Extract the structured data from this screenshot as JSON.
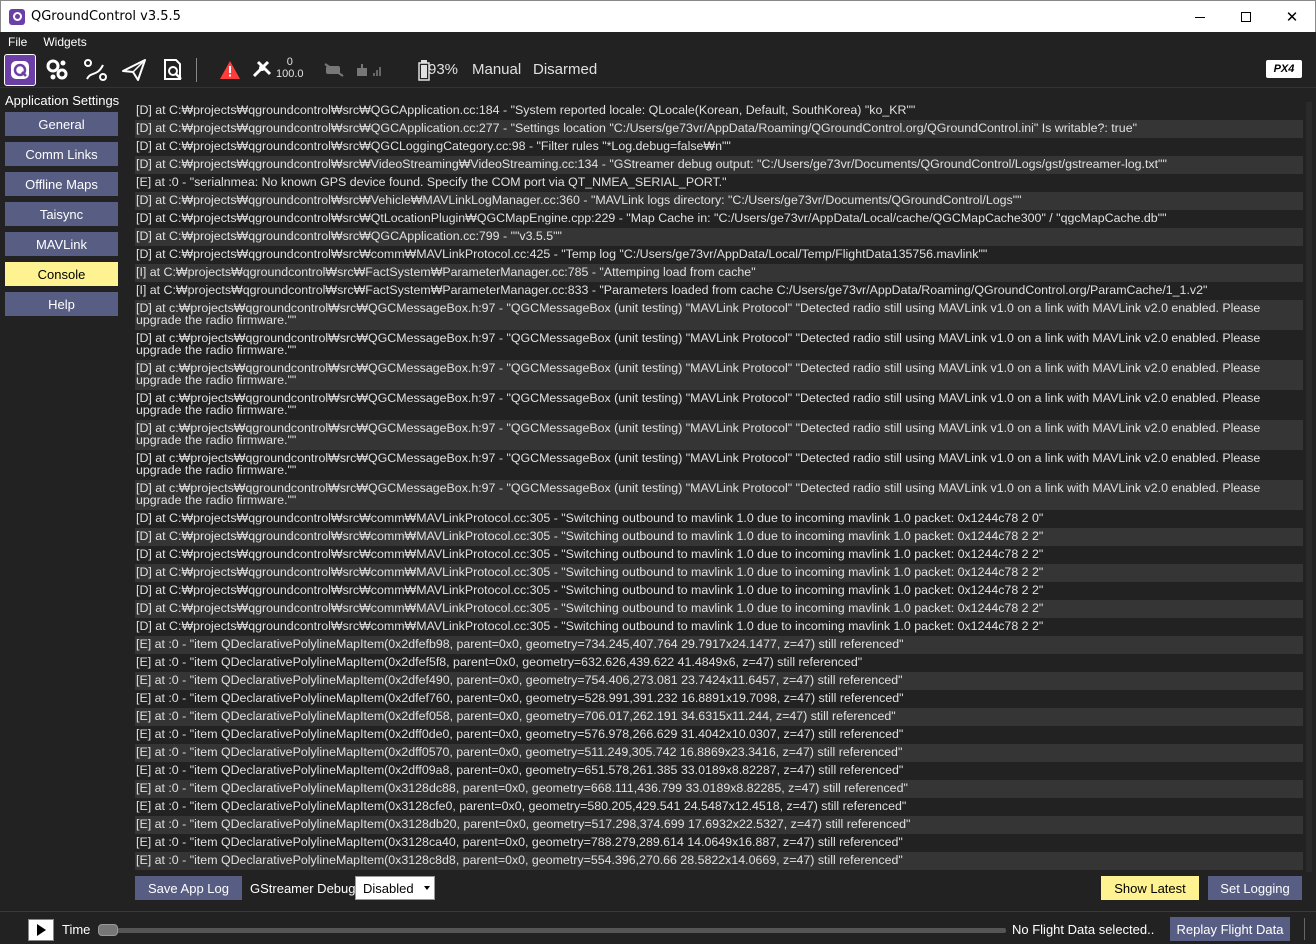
{
  "window": {
    "title": "QGroundControl v3.5.5",
    "minimize_icon": "minimize-icon",
    "maximize_icon": "maximize-icon",
    "close_glyph": "✕"
  },
  "menubar": {
    "items": [
      "File",
      "Widgets"
    ]
  },
  "toolbar": {
    "rssi_top": "0",
    "rssi_bottom": "100.0",
    "battery": "93%",
    "flight_mode": "Manual",
    "arm_state": "Disarmed",
    "brand_badge": "PX4",
    "icons": [
      "qgc-logo-icon",
      "gear-cluster-icon",
      "plan-waypoints-icon",
      "fly-paper-plane-icon",
      "analyze-doc-icon",
      "warning-triangle-icon",
      "gps-drone-icon",
      "telemetry-rc-icon",
      "radio-signal-icon",
      "battery-icon",
      "px4-logo-icon"
    ],
    "warning_color": "#ff3d3d"
  },
  "sidebar": {
    "header": "Application Settings",
    "items": [
      {
        "label": "General",
        "active": false
      },
      {
        "label": "Comm Links",
        "active": false
      },
      {
        "label": "Offline Maps",
        "active": false
      },
      {
        "label": "Taisync",
        "active": false
      },
      {
        "label": "MAVLink",
        "active": false
      },
      {
        "label": "Console",
        "active": true
      },
      {
        "label": "Help",
        "active": false
      }
    ]
  },
  "console": {
    "lines": [
      "[D] at C:₩projects₩qgroundcontrol₩src₩QGCApplication.cc:184 - \"System reported locale: QLocale(Korean, Default, SouthKorea) \"ko_KR\"\"",
      "[D] at C:₩projects₩qgroundcontrol₩src₩QGCApplication.cc:277 - \"Settings location \"C:/Users/ge73vr/AppData/Roaming/QGroundControl.org/QGroundControl.ini\" Is writable?: true\"",
      "[D] at C:₩projects₩qgroundcontrol₩src₩QGCLoggingCategory.cc:98 - \"Filter rules \"*Log.debug=false₩n\"\"",
      "[D] at C:₩projects₩qgroundcontrol₩src₩VideoStreaming₩VideoStreaming.cc:134 - \"GStreamer debug output: \"C:/Users/ge73vr/Documents/QGroundControl/Logs/gst/gstreamer-log.txt\"\"",
      "[E] at :0 - \"serialnmea: No known GPS device found. Specify the COM port via QT_NMEA_SERIAL_PORT.\"",
      "[D] at C:₩projects₩qgroundcontrol₩src₩Vehicle₩MAVLinkLogManager.cc:360 - \"MAVLink logs directory: \"C:/Users/ge73vr/Documents/QGroundControl/Logs\"\"",
      "[D] at C:₩projects₩qgroundcontrol₩src₩QtLocationPlugin₩QGCMapEngine.cpp:229 - \"Map Cache in: \"C:/Users/ge73vr/AppData/Local/cache/QGCMapCache300\" / \"qgcMapCache.db\"\"",
      "[D] at C:₩projects₩qgroundcontrol₩src₩QGCApplication.cc:799 - \"\"v3.5.5\"\"",
      "[D] at C:₩projects₩qgroundcontrol₩src₩comm₩MAVLinkProtocol.cc:425 - \"Temp log \"C:/Users/ge73vr/AppData/Local/Temp/FlightData135756.mavlink\"\"",
      "[I] at C:₩projects₩qgroundcontrol₩src₩FactSystem₩ParameterManager.cc:785 - \"Attemping load from cache\"",
      "[I] at C:₩projects₩qgroundcontrol₩src₩FactSystem₩ParameterManager.cc:833 - \"Parameters loaded from cache C:/Users/ge73vr/AppData/Roaming/QGroundControl.org/ParamCache/1_1.v2\"",
      "[D] at c:₩projects₩qgroundcontrol₩src₩QGCMessageBox.h:97 - \"QGCMessageBox (unit testing) \"MAVLink Protocol\" \"Detected radio still using MAVLink v1.0 on a link with MAVLink v2.0 enabled. Please upgrade the radio firmware.\"\"",
      "[D] at c:₩projects₩qgroundcontrol₩src₩QGCMessageBox.h:97 - \"QGCMessageBox (unit testing) \"MAVLink Protocol\" \"Detected radio still using MAVLink v1.0 on a link with MAVLink v2.0 enabled. Please upgrade the radio firmware.\"\"",
      "[D] at c:₩projects₩qgroundcontrol₩src₩QGCMessageBox.h:97 - \"QGCMessageBox (unit testing) \"MAVLink Protocol\" \"Detected radio still using MAVLink v1.0 on a link with MAVLink v2.0 enabled. Please upgrade the radio firmware.\"\"",
      "[D] at c:₩projects₩qgroundcontrol₩src₩QGCMessageBox.h:97 - \"QGCMessageBox (unit testing) \"MAVLink Protocol\" \"Detected radio still using MAVLink v1.0 on a link with MAVLink v2.0 enabled. Please upgrade the radio firmware.\"\"",
      "[D] at c:₩projects₩qgroundcontrol₩src₩QGCMessageBox.h:97 - \"QGCMessageBox (unit testing) \"MAVLink Protocol\" \"Detected radio still using MAVLink v1.0 on a link with MAVLink v2.0 enabled. Please upgrade the radio firmware.\"\"",
      "[D] at c:₩projects₩qgroundcontrol₩src₩QGCMessageBox.h:97 - \"QGCMessageBox (unit testing) \"MAVLink Protocol\" \"Detected radio still using MAVLink v1.0 on a link with MAVLink v2.0 enabled. Please upgrade the radio firmware.\"\"",
      "[D] at c:₩projects₩qgroundcontrol₩src₩QGCMessageBox.h:97 - \"QGCMessageBox (unit testing) \"MAVLink Protocol\" \"Detected radio still using MAVLink v1.0 on a link with MAVLink v2.0 enabled. Please upgrade the radio firmware.\"\"",
      "[D] at C:₩projects₩qgroundcontrol₩src₩comm₩MAVLinkProtocol.cc:305 - \"Switching outbound to mavlink 1.0 due to incoming mavlink 1.0 packet: 0x1244c78 2 0\"",
      "[D] at C:₩projects₩qgroundcontrol₩src₩comm₩MAVLinkProtocol.cc:305 - \"Switching outbound to mavlink 1.0 due to incoming mavlink 1.0 packet: 0x1244c78 2 2\"",
      "[D] at C:₩projects₩qgroundcontrol₩src₩comm₩MAVLinkProtocol.cc:305 - \"Switching outbound to mavlink 1.0 due to incoming mavlink 1.0 packet: 0x1244c78 2 2\"",
      "[D] at C:₩projects₩qgroundcontrol₩src₩comm₩MAVLinkProtocol.cc:305 - \"Switching outbound to mavlink 1.0 due to incoming mavlink 1.0 packet: 0x1244c78 2 2\"",
      "[D] at C:₩projects₩qgroundcontrol₩src₩comm₩MAVLinkProtocol.cc:305 - \"Switching outbound to mavlink 1.0 due to incoming mavlink 1.0 packet: 0x1244c78 2 2\"",
      "[D] at C:₩projects₩qgroundcontrol₩src₩comm₩MAVLinkProtocol.cc:305 - \"Switching outbound to mavlink 1.0 due to incoming mavlink 1.0 packet: 0x1244c78 2 2\"",
      "[D] at C:₩projects₩qgroundcontrol₩src₩comm₩MAVLinkProtocol.cc:305 - \"Switching outbound to mavlink 1.0 due to incoming mavlink 1.0 packet: 0x1244c78 2 2\"",
      "[E] at :0 - \"item  QDeclarativePolylineMapItem(0x2dfefb98, parent=0x0, geometry=734.245,407.764 29.7917x24.1477, z=47)  still referenced\"",
      "[E] at :0 - \"item  QDeclarativePolylineMapItem(0x2dfef5f8, parent=0x0, geometry=632.626,439.622 41.4849x6, z=47)  still referenced\"",
      "[E] at :0 - \"item  QDeclarativePolylineMapItem(0x2dfef490, parent=0x0, geometry=754.406,273.081 23.7424x11.6457, z=47)  still referenced\"",
      "[E] at :0 - \"item  QDeclarativePolylineMapItem(0x2dfef760, parent=0x0, geometry=528.991,391.232 16.8891x19.7098, z=47)  still referenced\"",
      "[E] at :0 - \"item  QDeclarativePolylineMapItem(0x2dfef058, parent=0x0, geometry=706.017,262.191 34.6315x11.244, z=47)  still referenced\"",
      "[E] at :0 - \"item  QDeclarativePolylineMapItem(0x2dff0de0, parent=0x0, geometry=576.978,266.629 31.4042x10.0307, z=47)  still referenced\"",
      "[E] at :0 - \"item  QDeclarativePolylineMapItem(0x2dff0570, parent=0x0, geometry=511.249,305.742 16.8869x23.3416, z=47)  still referenced\"",
      "[E] at :0 - \"item  QDeclarativePolylineMapItem(0x2dff09a8, parent=0x0, geometry=651.578,261.385 33.0189x8.82287, z=47)  still referenced\"",
      "[E] at :0 - \"item  QDeclarativePolylineMapItem(0x3128dc88, parent=0x0, geometry=668.111,436.799 33.0189x8.82285, z=47)  still referenced\"",
      "[E] at :0 - \"item  QDeclarativePolylineMapItem(0x3128cfe0, parent=0x0, geometry=580.205,429.541 24.5487x12.4518, z=47)  still referenced\"",
      "[E] at :0 - \"item  QDeclarativePolylineMapItem(0x3128db20, parent=0x0, geometry=517.298,374.699 17.6932x22.5327, z=47)  still referenced\"",
      "[E] at :0 - \"item  QDeclarativePolylineMapItem(0x3128ca40, parent=0x0, geometry=788.279,289.614 14.0649x16.887, z=47)  still referenced\"",
      "[E] at :0 - \"item  QDeclarativePolylineMapItem(0x3128c8d8, parent=0x0, geometry=554.396,270.66 28.5822x14.0669, z=47)  still referenced\""
    ]
  },
  "console_controls": {
    "save_label": "Save App Log",
    "gst_label": "GStreamer Debug",
    "gst_value": "Disabled",
    "show_latest_label": "Show Latest",
    "set_logging_label": "Set Logging"
  },
  "footer": {
    "time_label": "Time",
    "status": "No Flight Data selected..",
    "replay_label": "Replay Flight Data",
    "progress": 0
  },
  "colors": {
    "accent_purple": "#6c3fa6",
    "button_blue": "#585d83",
    "highlight_yellow": "#fff291"
  }
}
